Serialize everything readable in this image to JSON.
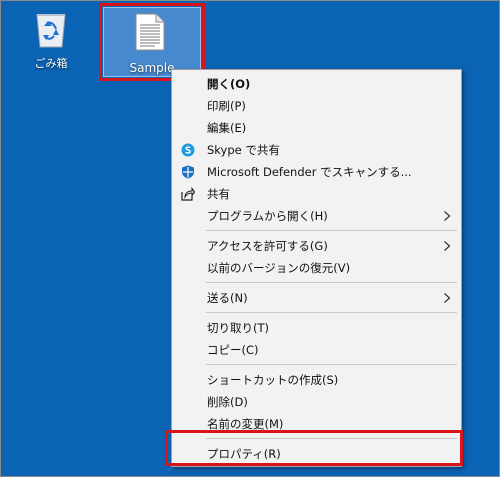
{
  "desktop": {
    "background_color": "#0b63b4",
    "icons": [
      {
        "label": "ごみ箱",
        "icon": "recycle-bin-icon"
      },
      {
        "label": "Sample",
        "icon": "text-document-icon"
      }
    ]
  },
  "highlight_color": "#d9151b",
  "context_menu": {
    "open": "開く(O)",
    "print": "印刷(P)",
    "edit": "編集(E)",
    "skype_share": "Skype で共有",
    "defender_scan": "Microsoft Defender でスキャンする...",
    "share": "共有",
    "open_with": "プログラムから開く(H)",
    "give_access": "アクセスを許可する(G)",
    "restore_versions": "以前のバージョンの復元(V)",
    "send_to": "送る(N)",
    "cut": "切り取り(T)",
    "copy": "コピー(C)",
    "create_shortcut": "ショートカットの作成(S)",
    "delete": "削除(D)",
    "rename": "名前の変更(M)",
    "properties": "プロパティ(R)"
  }
}
